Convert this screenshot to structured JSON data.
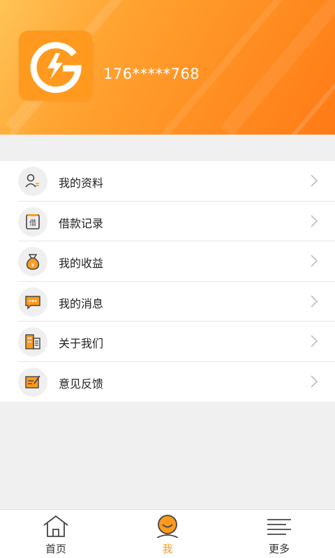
{
  "profile": {
    "phone": "176*****768"
  },
  "menu": {
    "items": [
      {
        "label": "我的资料",
        "icon": "profile-icon"
      },
      {
        "label": "借款记录",
        "icon": "loan-record-icon"
      },
      {
        "label": "我的收益",
        "icon": "money-bag-icon"
      },
      {
        "label": "我的消息",
        "icon": "message-icon"
      },
      {
        "label": "关于我们",
        "icon": "building-icon"
      },
      {
        "label": "意见反馈",
        "icon": "feedback-icon"
      }
    ]
  },
  "tabbar": {
    "tabs": [
      {
        "label": "首页",
        "icon": "home-icon"
      },
      {
        "label": "我",
        "icon": "user-icon",
        "active": true
      },
      {
        "label": "更多",
        "icon": "menu-icon"
      }
    ]
  },
  "colors": {
    "accent": "#ff9a1e",
    "header_start": "#ffc457",
    "header_end": "#ff7a16"
  }
}
